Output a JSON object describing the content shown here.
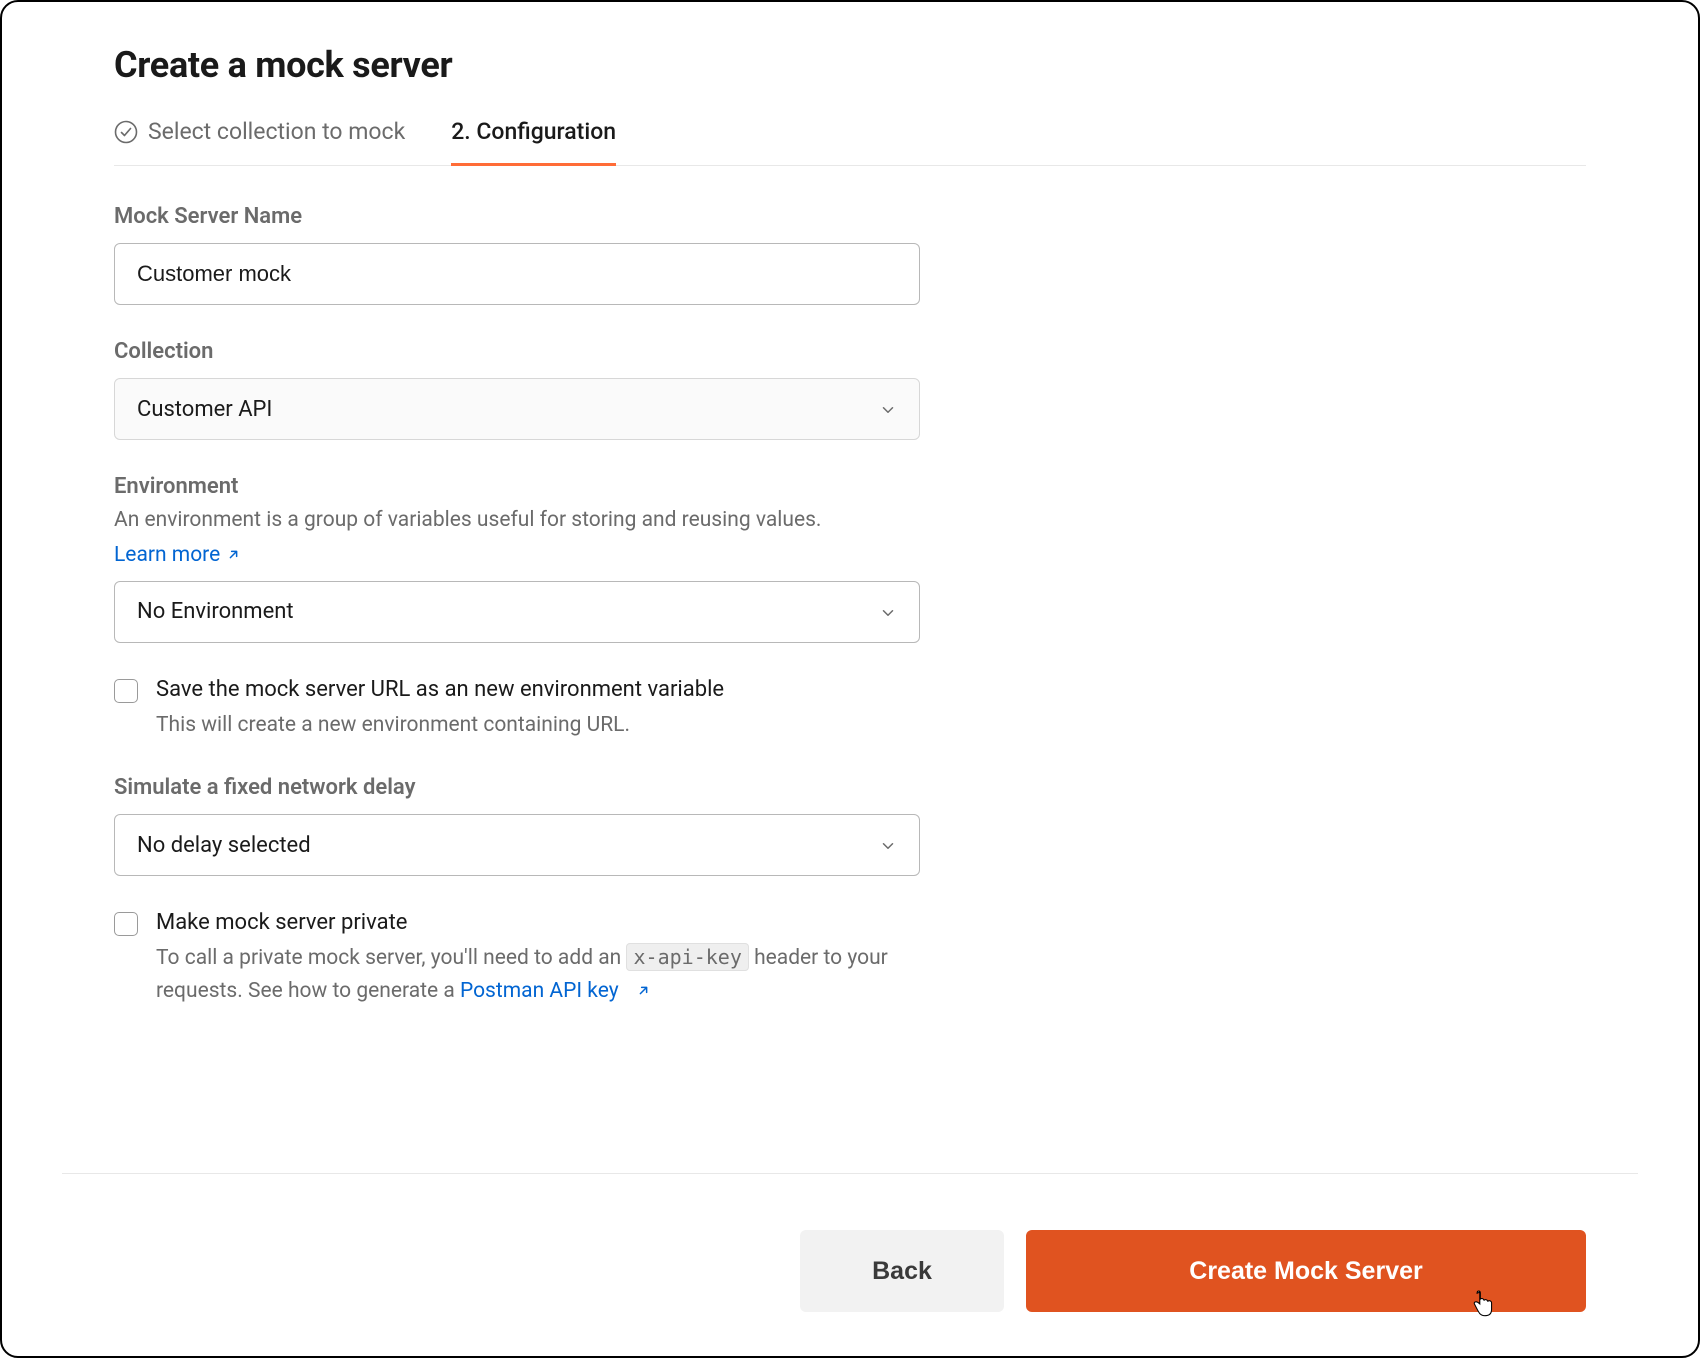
{
  "page": {
    "title": "Create a mock server"
  },
  "tabs": {
    "step1": "Select collection to mock",
    "step2": "2.  Configuration"
  },
  "fields": {
    "name": {
      "label": "Mock Server Name",
      "value": "Customer mock"
    },
    "collection": {
      "label": "Collection",
      "selected": "Customer API"
    },
    "environment": {
      "label": "Environment",
      "help": "An environment is a group of variables useful for storing and reusing values.",
      "learnMore": "Learn more",
      "selected": "No Environment"
    },
    "saveUrl": {
      "label": "Save the mock server URL as an new environment variable",
      "help": "This will create a new environment containing URL."
    },
    "delay": {
      "label": "Simulate a fixed network delay",
      "selected": "No delay selected"
    },
    "private": {
      "label": "Make mock server private",
      "helpPre": "To call a private mock server, you'll need to add an ",
      "code": "x-api-key",
      "helpMid": " header to your requests. See how to generate a ",
      "link": "Postman API key"
    }
  },
  "footer": {
    "back": "Back",
    "create": "Create Mock Server"
  }
}
